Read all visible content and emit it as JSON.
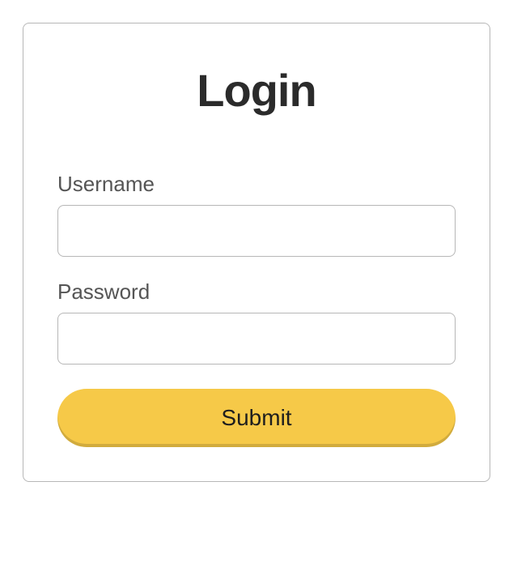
{
  "title": "Login",
  "fields": {
    "username": {
      "label": "Username",
      "value": ""
    },
    "password": {
      "label": "Password",
      "value": ""
    }
  },
  "submit_label": "Submit",
  "colors": {
    "accent": "#f6c948"
  }
}
